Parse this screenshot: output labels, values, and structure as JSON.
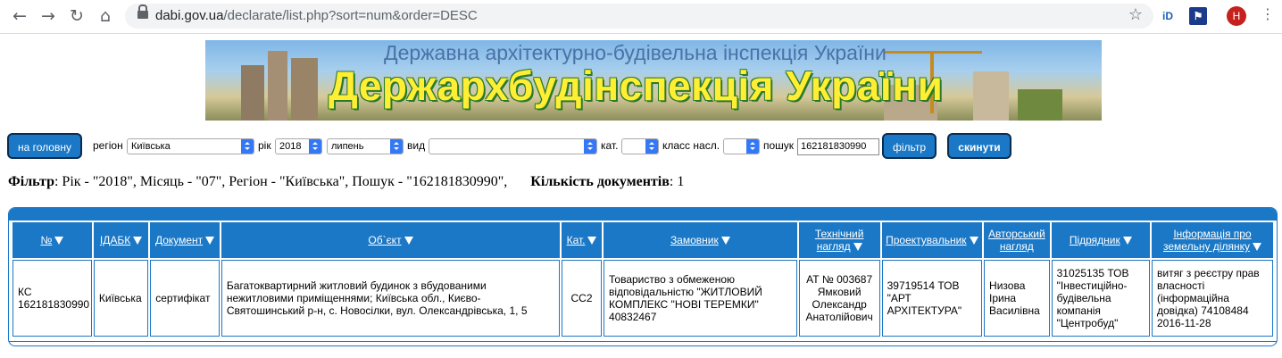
{
  "browser": {
    "url_host": "dabi.gov.ua",
    "url_path": "/declarate/list.php?sort=num&order=DESC",
    "avatar_letter": "H",
    "ext1": "iD"
  },
  "banner": {
    "subtitle": "Державна архітектурно-будівельна інспекція України",
    "title": "Держархбудінспекція України"
  },
  "filters": {
    "home_label": "на головну",
    "region_label": "регіон",
    "region_value": "Київська",
    "year_label": "рік",
    "year_value": "2018",
    "month_value": "липень",
    "kind_label": "вид",
    "kind_value": "",
    "cat_label": "кат.",
    "cat_value": "",
    "class_label": "класс насл.",
    "class_value": "",
    "search_label": "пошук",
    "search_value": "162181830990",
    "filter_btn": "фільтр",
    "reset_btn": "скинути"
  },
  "summary": {
    "filter_label": "Фільтр",
    "filter_text": ": Рік - \"2018\", Місяць - \"07\", Регіон - \"Київська\", Пошук - \"162181830990\",",
    "count_label": "Кількість документів",
    "count_text": ": 1"
  },
  "table": {
    "headers": {
      "num": "№",
      "idabk": "ІДАБК",
      "document": "Документ",
      "object": "Об`єкт",
      "cat": "Кат.",
      "customer": "Замовник",
      "tech1": "Технічний",
      "tech2": "нагляд",
      "designer": "Проектувальник",
      "author1": "Авторський",
      "author2": "нагляд",
      "contractor": "Підрядник",
      "land1": "Інформація про",
      "land2": "земельну ділянку"
    },
    "rows": [
      {
        "num1": "КС",
        "num2": "162181830990",
        "idabk": "Київська",
        "document": "сертифікат",
        "object": "Багатоквартирний житловий будинок з вбудованими нежитловими приміщеннями; Київська обл., Києво-Святошинський р-н, с. Новосілки, вул. Олександрівська, 1, 5",
        "cat": "СС2",
        "customer": "Товариство з обмеженою відповідальністю \"ЖИТЛОВИЙ КОМПЛЕКС \"НОВІ ТЕРЕМКИ\" 40832467",
        "tech": "АТ № 003687 Ямковий Олександр Анатолійович",
        "designer": "39719514 ТОВ \"АРТ АРХІТЕКТУРА\"",
        "author": "Низова Ірина Василівна",
        "contractor": "31025135 ТОВ \"Інвестиційно-будівельна компанія \"Центробуд\"",
        "land": "витяг з реєстру прав власності (інформаційна довідка) 74108484 2016-11-28"
      }
    ]
  }
}
